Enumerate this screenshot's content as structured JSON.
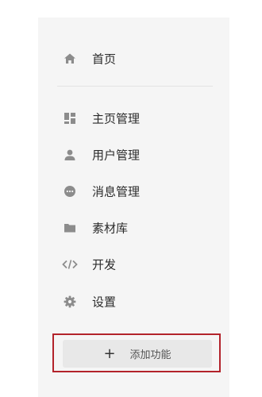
{
  "sidebar": {
    "home": {
      "label": "首页",
      "icon": "home-icon"
    },
    "items": [
      {
        "label": "主页管理",
        "icon": "dashboard-icon"
      },
      {
        "label": "用户管理",
        "icon": "user-icon"
      },
      {
        "label": "消息管理",
        "icon": "message-icon"
      },
      {
        "label": "素材库",
        "icon": "folder-icon"
      },
      {
        "label": "开发",
        "icon": "code-icon"
      },
      {
        "label": "设置",
        "icon": "gear-icon"
      }
    ],
    "add_button": {
      "plus": "+",
      "label": "添加功能"
    }
  },
  "colors": {
    "sidebar_bg": "#f5f5f5",
    "icon": "#8c8c8c",
    "highlight_border": "#b3232b",
    "add_button_bg": "#e8e8e8"
  }
}
